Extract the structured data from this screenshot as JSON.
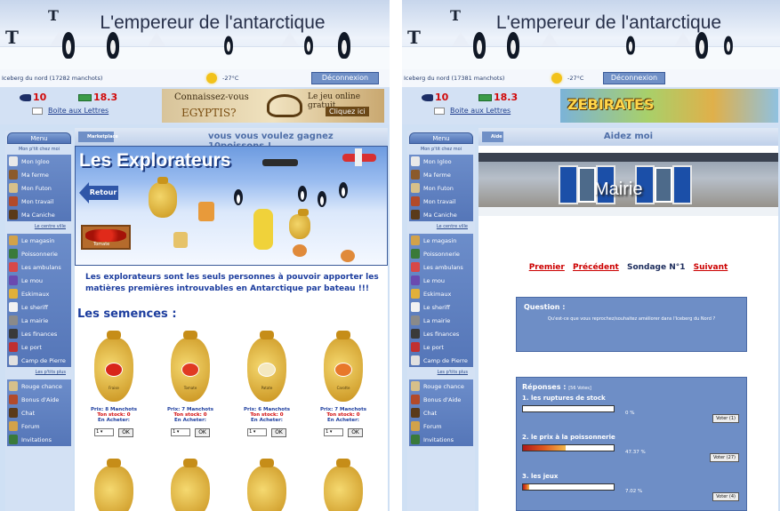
{
  "left": {
    "banner_title": "L'empereur de l'antarctique",
    "location": "Iceberg du nord (17282 manchots)",
    "temperature": "-27°C",
    "logout": "Déconnexion",
    "fish": "10",
    "money": "18.3",
    "mailbox": "Boite aux Lettres",
    "ad": {
      "line1": "Connaissez-vous",
      "line2": "EGYPTIS?",
      "line3": "Le jeu online gratuit",
      "button": "Cliquez ici"
    },
    "menu": {
      "header": "Menu",
      "sub": "Mon p'tit chez moi",
      "group1": [
        "Mon Igloo",
        "Ma ferme",
        "Mon Futon",
        "Mon travail",
        "Ma Caniche"
      ],
      "link1": "Le centre ville",
      "group2": [
        "Le magasin",
        "Poissonnerie",
        "Les ambulans",
        "Le mou",
        "Eskimaux",
        "Le sheriff",
        "La mairie",
        "Les finances",
        "Le port",
        "Camp de Pierre"
      ],
      "link2": "Les p'tits plus",
      "group3": [
        "Rouge chance",
        "Bonus d'Aide",
        "Chat",
        "Forum",
        "Invitations"
      ]
    },
    "topbar": {
      "tab": "Marketplace",
      "marquee": "vous vous voulez gagnez 10poissons !"
    },
    "hero": {
      "title": "Les Explorateurs",
      "back": "Retour",
      "crate": "Tomate"
    },
    "description": "Les explorateurs sont les seuls personnes à pouvoir apporter les matières premières introuvables en Antarctique par bateau !!!",
    "seeds_heading": "Les semences :",
    "products": [
      {
        "label": "Fraise",
        "price": "Prix: 8 Manchots",
        "stock": "Ton stock: 0",
        "buy": "En Acheter:",
        "qty": "1",
        "ok": "OK"
      },
      {
        "label": "Tomate",
        "price": "Prix: 7 Manchots",
        "stock": "Ton stock: 0",
        "buy": "En Acheter:",
        "qty": "1",
        "ok": "OK"
      },
      {
        "label": "Patate",
        "price": "Prix: 6 Manchots",
        "stock": "Ton stock: 0",
        "buy": "En Acheter:",
        "qty": "1",
        "ok": "OK"
      },
      {
        "label": "Carotte",
        "price": "Prix: 7 Manchots",
        "stock": "Ton stock: 0",
        "buy": "En Acheter:",
        "qty": "1",
        "ok": "OK"
      }
    ]
  },
  "right": {
    "banner_title": "L'empereur de l'antarctique",
    "location": "Iceberg du nord (17381 manchots)",
    "temperature": "-27°C",
    "logout": "Déconnexion",
    "fish": "10",
    "money": "18.3",
    "mailbox": "Boite aux Lettres",
    "ad": {
      "line1": "ZEBIRATES"
    },
    "menu": {
      "header": "Menu",
      "sub": "Mon p'tit chez moi",
      "group1": [
        "Mon Igloo",
        "Ma ferme",
        "Mon Futon",
        "Mon travail",
        "Ma Caniche"
      ],
      "link1": "Le centre ville",
      "group2": [
        "Le magasin",
        "Poissonnerie",
        "Les ambulans",
        "Le mou",
        "Eskimaux",
        "Le sheriff",
        "La mairie",
        "Les finances",
        "Le port",
        "Camp de Pierre"
      ],
      "link2": "Les p'tits plus",
      "group3": [
        "Rouge chance",
        "Bonus d'Aide",
        "Chat",
        "Forum",
        "Invitations"
      ]
    },
    "topbar": {
      "tab": "Aide",
      "title": "Aidez moi"
    },
    "hero_title": "Mairie",
    "nav": {
      "first": "Premier",
      "prev": "Précédent",
      "current": "Sondage N°1",
      "next": "Suivant"
    },
    "question": {
      "label": "Question :",
      "text": "Qu'est-ce que vous reprochez/souhaitez améliorer dans l'Iceberg du Nord ?"
    },
    "answers": {
      "label": "Réponses :",
      "votes": "[56 Votes]",
      "items": [
        {
          "text": "1. les ruptures de stock",
          "pct": "0 %",
          "value": 0,
          "vote": "Voter (1)"
        },
        {
          "text": "2. le prix à la poissonnerie",
          "pct": "47.37 %",
          "value": 47.37,
          "vote": "Voter (27)"
        },
        {
          "text": "3. les jeux",
          "pct": "7.02 %",
          "value": 7.02,
          "vote": "Voter (4)"
        }
      ]
    }
  }
}
